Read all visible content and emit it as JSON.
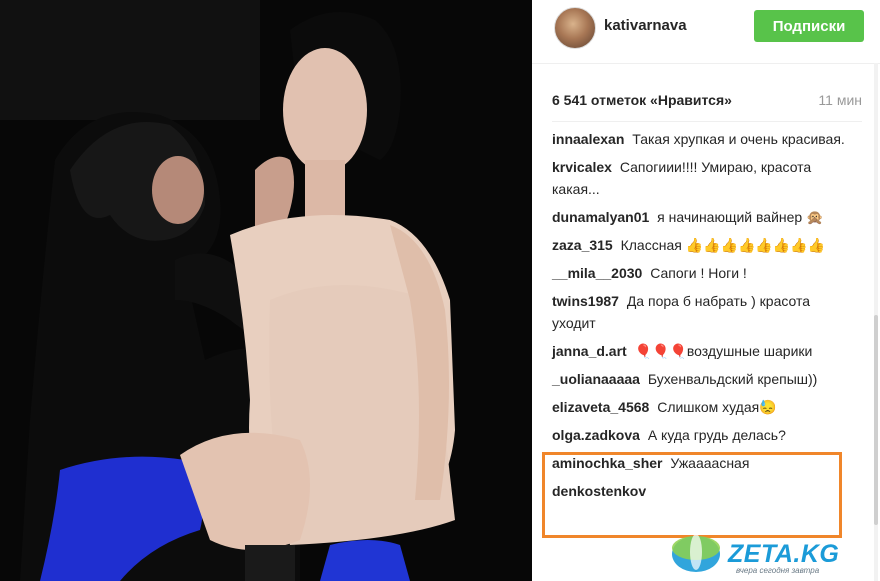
{
  "header": {
    "username": "kativarnava",
    "follow_label": "Подписки"
  },
  "post": {
    "likes": "6 541 отметок «Нравится»",
    "time": "11 мин"
  },
  "comments": [
    {
      "user": "innaalexan",
      "text": "Такая хрупкая и очень красивая."
    },
    {
      "user": "krvicalex",
      "text": "Сапогиии!!!! Умираю, красота какая..."
    },
    {
      "user": "dunamalyan01",
      "text": "я начинающий вайнер 🙊"
    },
    {
      "user": "zaza_315",
      "text": "Классная 👍👍👍👍👍👍👍👍"
    },
    {
      "user": "__mila__2030",
      "text": "Сапоги ! Ноги !"
    },
    {
      "user": "twins1987",
      "text": "Да пора б набрать ) красота уходит"
    },
    {
      "user": "janna_d.art",
      "text": "🎈🎈🎈воздушные шарики"
    },
    {
      "user": "_uolianaaaaa",
      "text": "Бухенвальдский крепыш))"
    },
    {
      "user": "elizaveta_4568",
      "text": "Слишком худая😓"
    },
    {
      "user": "olga.zadkova",
      "text": "А куда грудь делась?"
    },
    {
      "user": "aminochka_sher",
      "text": "Ужаааасная"
    },
    {
      "user": "denkostenkov",
      "text": ""
    }
  ],
  "watermark": {
    "brand": "ZETA.KG",
    "tagline": "вчера сегодня завтра"
  },
  "colors": {
    "follow_button": "#58c34a",
    "highlight_box": "#f0862a",
    "watermark_blue": "#1b9bd8"
  }
}
